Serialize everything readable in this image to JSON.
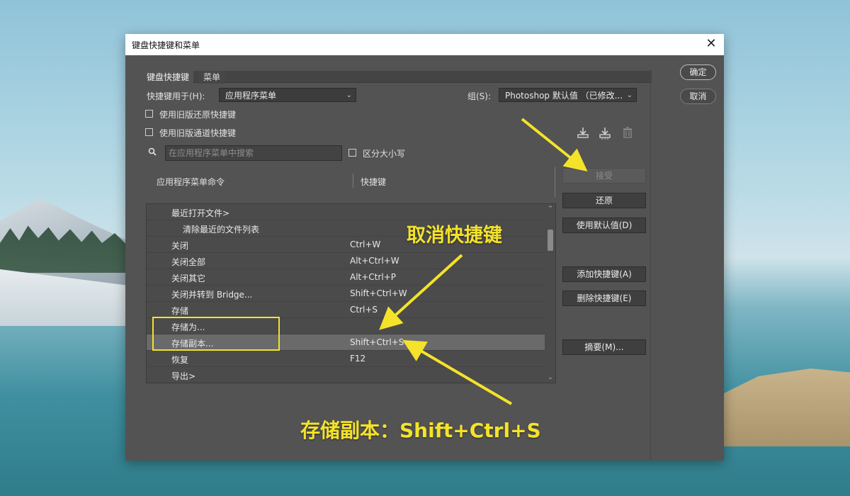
{
  "dialog": {
    "title": "键盘快捷键和菜单",
    "tabs": [
      "键盘快捷键",
      "菜单"
    ],
    "shortcuts_for_label": "快捷键用于(H):",
    "shortcuts_for_value": "应用程序菜单",
    "group_label": "组(S):",
    "group_value": "Photoshop 默认值 （已修改...",
    "checkbox_legacy_undo": "使用旧版还原快捷键",
    "checkbox_legacy_channel": "使用旧版通道快捷键",
    "search_placeholder": "在应用程序菜单中搜索",
    "case_sensitive": "区分大小写",
    "col_command": "应用程序菜单命令",
    "col_shortcut": "快捷键",
    "rows": [
      {
        "cmd": "最近打开文件>",
        "key": ""
      },
      {
        "cmd": "清除最近的文件列表",
        "key": ""
      },
      {
        "cmd": "关闭",
        "key": "Ctrl+W"
      },
      {
        "cmd": "关闭全部",
        "key": "Alt+Ctrl+W"
      },
      {
        "cmd": "关闭其它",
        "key": "Alt+Ctrl+P"
      },
      {
        "cmd": "关闭并转到 Bridge...",
        "key": "Shift+Ctrl+W"
      },
      {
        "cmd": "存储",
        "key": "Ctrl+S"
      },
      {
        "cmd": "存储为...",
        "key": ""
      },
      {
        "cmd": "存储副本...",
        "key": "Shift+Ctrl+S"
      },
      {
        "cmd": "恢复",
        "key": "F12"
      },
      {
        "cmd": "导出>",
        "key": ""
      }
    ],
    "buttons": {
      "ok": "确定",
      "cancel": "取消",
      "accept": "接受",
      "undo": "还原",
      "use_default": "使用默认值(D)",
      "add_shortcut": "添加快捷键(A)",
      "delete_shortcut": "删除快捷键(E)",
      "summary": "摘要(M)..."
    }
  },
  "annotations": {
    "cancel_shortcut": "取消快捷键",
    "save_copy": "存储副本：Shift+Ctrl+S"
  },
  "colors": {
    "accent_yellow": "#f4e32a",
    "dialog_bg": "#535353"
  }
}
